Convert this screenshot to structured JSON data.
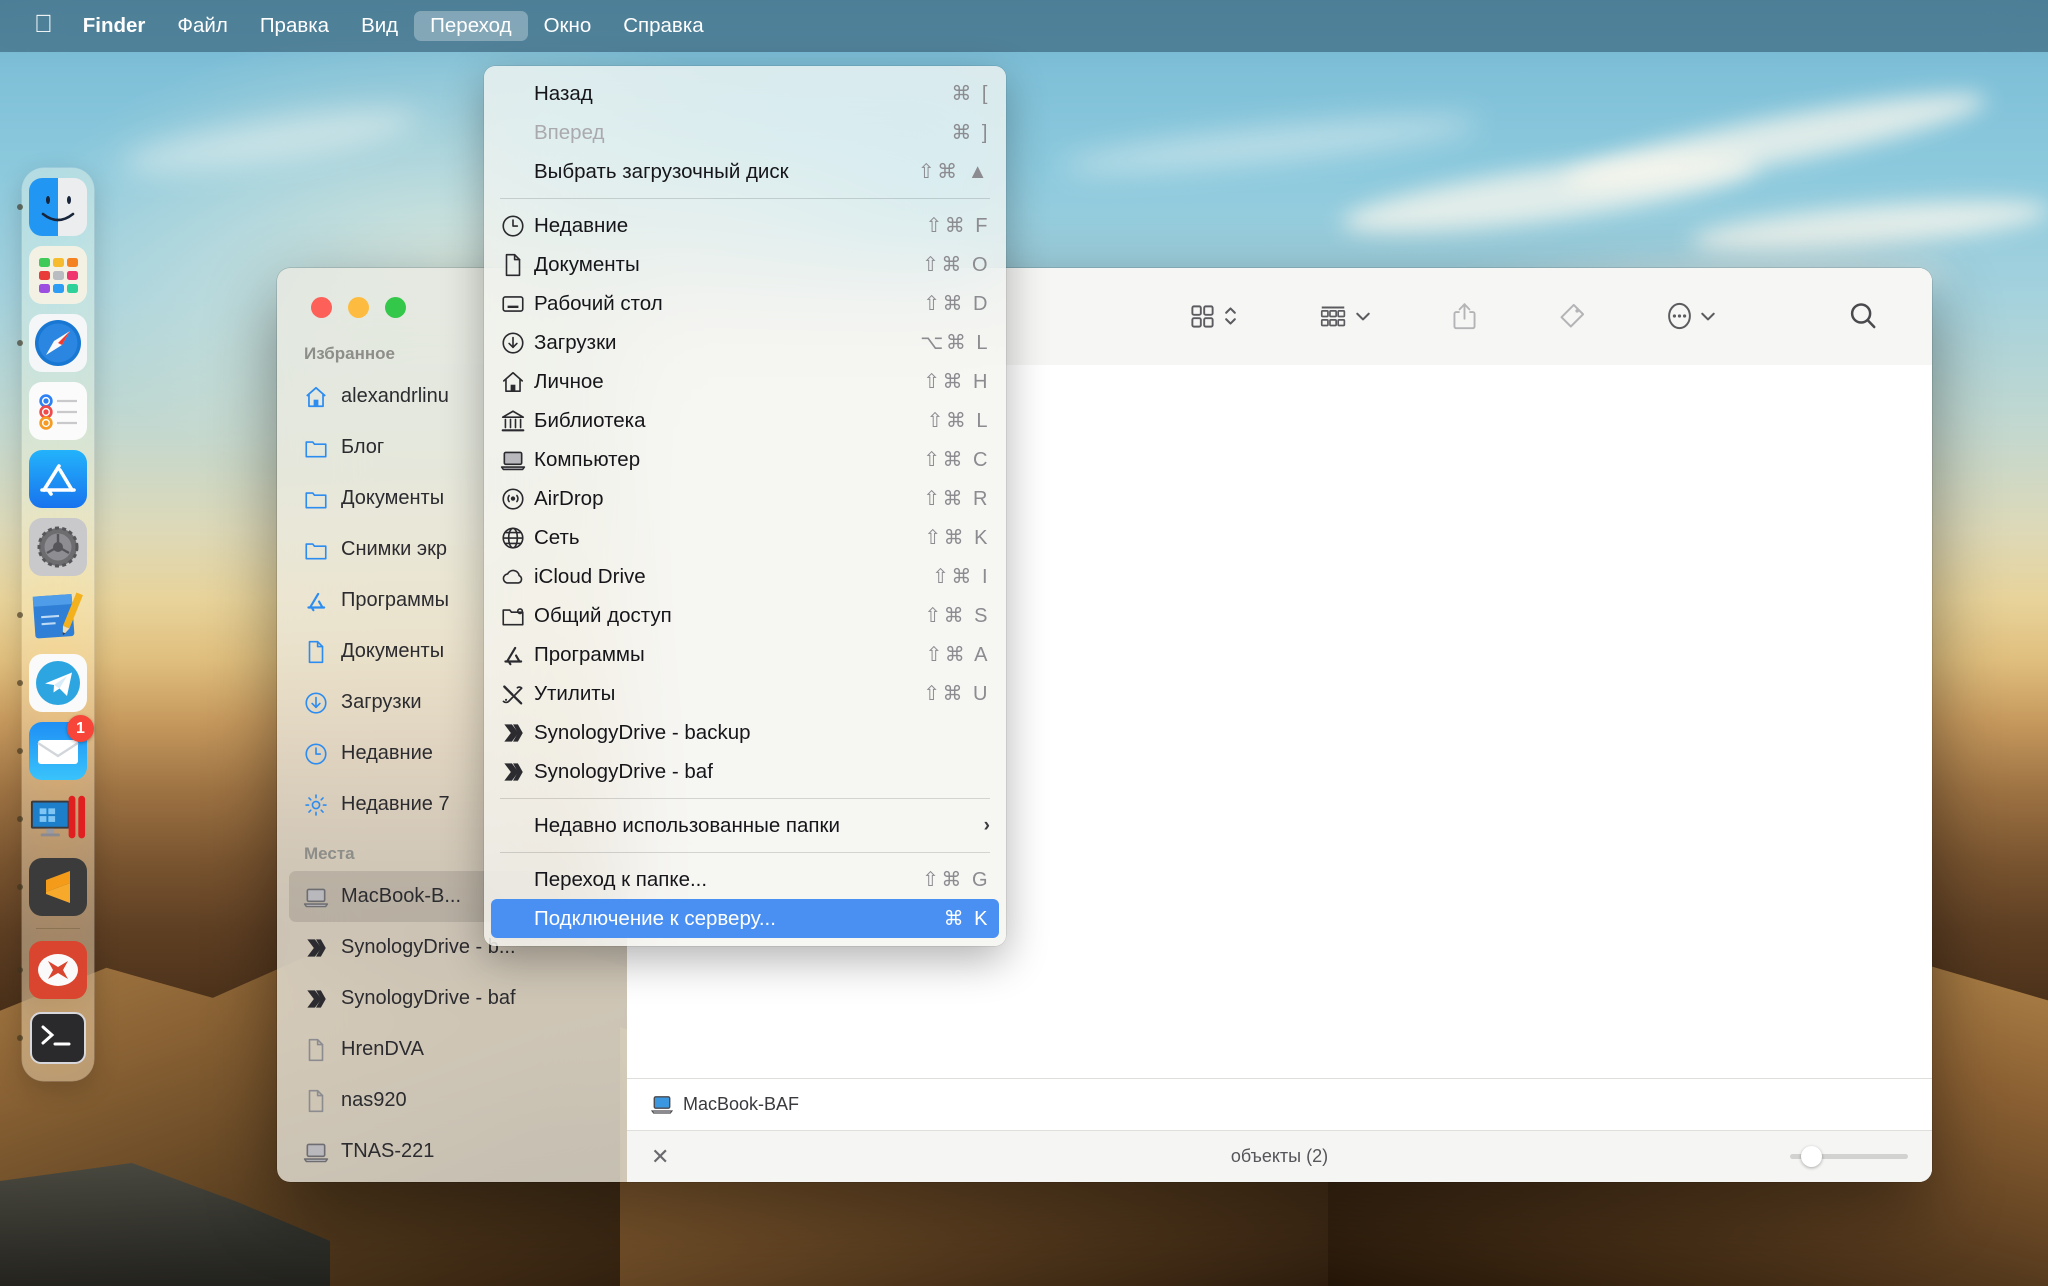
{
  "menubar": {
    "apple_icon": "apple-logo",
    "items": [
      {
        "label": "Finder",
        "bold": true,
        "active": false
      },
      {
        "label": "Файл",
        "bold": false,
        "active": false
      },
      {
        "label": "Правка",
        "bold": false,
        "active": false
      },
      {
        "label": "Вид",
        "bold": false,
        "active": false
      },
      {
        "label": "Переход",
        "bold": false,
        "active": true
      },
      {
        "label": "Окно",
        "bold": false,
        "active": false
      },
      {
        "label": "Справка",
        "bold": false,
        "active": false
      }
    ]
  },
  "go_menu": {
    "items": [
      {
        "label": "Назад",
        "shortcut": "⌘ [",
        "icon": "",
        "state": "normal"
      },
      {
        "label": "Вперед",
        "shortcut": "⌘ ]",
        "icon": "",
        "state": "disabled"
      },
      {
        "label": "Выбрать загрузочный диск",
        "shortcut": "⇧⌘ ▲",
        "icon": "",
        "state": "normal"
      },
      {
        "separator": true
      },
      {
        "label": "Недавние",
        "shortcut": "⇧⌘ F",
        "icon": "clock-icon",
        "state": "normal"
      },
      {
        "label": "Документы",
        "shortcut": "⇧⌘ O",
        "icon": "document-icon",
        "state": "normal"
      },
      {
        "label": "Рабочий стол",
        "shortcut": "⇧⌘ D",
        "icon": "desktop-icon",
        "state": "normal"
      },
      {
        "label": "Загрузки",
        "shortcut": "⌥⌘ L",
        "icon": "download-icon",
        "state": "normal"
      },
      {
        "label": "Личное",
        "shortcut": "⇧⌘ H",
        "icon": "home-icon",
        "state": "normal"
      },
      {
        "label": "Библиотека",
        "shortcut": "⇧⌘ L",
        "icon": "library-icon",
        "state": "normal"
      },
      {
        "label": "Компьютер",
        "shortcut": "⇧⌘ C",
        "icon": "computer-icon",
        "state": "normal"
      },
      {
        "label": "AirDrop",
        "shortcut": "⇧⌘ R",
        "icon": "airdrop-icon",
        "state": "normal"
      },
      {
        "label": "Сеть",
        "shortcut": "⇧⌘ K",
        "icon": "globe-icon",
        "state": "normal"
      },
      {
        "label": "iCloud Drive",
        "shortcut": "⇧⌘ I",
        "icon": "cloud-icon",
        "state": "normal"
      },
      {
        "label": "Общий доступ",
        "shortcut": "⇧⌘ S",
        "icon": "shared-folder-icon",
        "state": "normal"
      },
      {
        "label": "Программы",
        "shortcut": "⇧⌘ A",
        "icon": "applications-icon",
        "state": "normal"
      },
      {
        "label": "Утилиты",
        "shortcut": "⇧⌘ U",
        "icon": "utilities-icon",
        "state": "normal"
      },
      {
        "label": "SynologyDrive - backup",
        "shortcut": "",
        "icon": "synology-icon",
        "state": "normal"
      },
      {
        "label": "SynologyDrive - baf",
        "shortcut": "",
        "icon": "synology-icon",
        "state": "normal"
      },
      {
        "separator": true
      },
      {
        "label": "Недавно использованные папки",
        "shortcut": "",
        "icon": "",
        "state": "normal",
        "submenu": true
      },
      {
        "separator": true
      },
      {
        "label": "Переход к папке...",
        "shortcut": "⇧⌘ G",
        "icon": "",
        "state": "normal"
      },
      {
        "label": "Подключение к серверу...",
        "shortcut": "⌘ K",
        "icon": "",
        "state": "selected"
      }
    ],
    "highlight_color": "#4a90f2"
  },
  "finder": {
    "sidebar": {
      "sections": [
        {
          "title": "Избранное",
          "items": [
            {
              "label": "alexandrlinu",
              "icon": "home-icon",
              "selected": false
            },
            {
              "label": "Блог",
              "icon": "folder-icon",
              "selected": false
            },
            {
              "label": "Документы",
              "icon": "folder-icon",
              "selected": false
            },
            {
              "label": "Снимки экр",
              "icon": "folder-icon",
              "selected": false
            },
            {
              "label": "Программы",
              "icon": "applications-icon",
              "selected": false
            },
            {
              "label": "Документы",
              "icon": "document-icon",
              "selected": false
            },
            {
              "label": "Загрузки",
              "icon": "download-icon",
              "selected": false
            },
            {
              "label": "Недавние",
              "icon": "clock-icon",
              "selected": false
            },
            {
              "label": "Недавние 7",
              "icon": "gear-icon",
              "selected": false
            }
          ]
        },
        {
          "title": "Места",
          "items": [
            {
              "label": "MacBook-B...",
              "icon": "computer-icon",
              "selected": true
            },
            {
              "label": "SynologyDrive - b...",
              "icon": "synology-icon",
              "selected": false
            },
            {
              "label": "SynologyDrive - baf",
              "icon": "synology-icon",
              "selected": false
            },
            {
              "label": "HrenDVA",
              "icon": "disk-icon",
              "selected": false
            },
            {
              "label": "nas920",
              "icon": "disk-icon",
              "selected": false
            },
            {
              "label": "TNAS-221",
              "icon": "computer-icon",
              "selected": false
            }
          ]
        }
      ]
    },
    "toolbar": {
      "buttons": [
        {
          "name": "view-grid-button",
          "icon": "grid-view-icon",
          "chevron": "updown"
        },
        {
          "name": "group-by-button",
          "icon": "group-list-icon",
          "chevron": "down"
        },
        {
          "name": "share-button",
          "icon": "share-icon",
          "chevron": ""
        },
        {
          "name": "tags-button",
          "icon": "tag-icon",
          "chevron": ""
        },
        {
          "name": "more-button",
          "icon": "ellipsis-icon",
          "chevron": "down"
        },
        {
          "name": "search-button",
          "icon": "search-icon",
          "chevron": ""
        }
      ]
    },
    "breadcrumb": {
      "icon": "computer-icon",
      "label": "MacBook-BAF"
    },
    "status": {
      "stop_icon": "stop-progress-icon",
      "count_label": "объекты (2)",
      "zoom_value": 12
    }
  },
  "dock": {
    "items": [
      {
        "name": "finder",
        "label": "Finder",
        "running": true,
        "badge": ""
      },
      {
        "name": "launchpad",
        "label": "Launchpad",
        "running": false,
        "badge": ""
      },
      {
        "name": "safari",
        "label": "Safari",
        "running": true,
        "badge": ""
      },
      {
        "name": "reminders",
        "label": "Напоминания",
        "running": false,
        "badge": ""
      },
      {
        "name": "app-store",
        "label": "App Store",
        "running": false,
        "badge": ""
      },
      {
        "name": "system-settings",
        "label": "Системные настройки",
        "running": false,
        "badge": ""
      },
      {
        "name": "notes",
        "label": "Заметки",
        "running": true,
        "badge": ""
      },
      {
        "name": "telegram",
        "label": "Telegram",
        "running": true,
        "badge": ""
      },
      {
        "name": "mail",
        "label": "Почта",
        "running": true,
        "badge": "1"
      },
      {
        "name": "parallels",
        "label": "Parallels Desktop",
        "running": true,
        "badge": ""
      },
      {
        "name": "sublime-text",
        "label": "Sublime Text",
        "running": true,
        "badge": ""
      },
      {
        "name": "separator",
        "label": "",
        "running": false,
        "badge": ""
      },
      {
        "name": "rdp-client",
        "label": "RDP Client",
        "running": true,
        "badge": ""
      },
      {
        "name": "terminal",
        "label": "Терминал",
        "running": true,
        "badge": ""
      }
    ]
  }
}
